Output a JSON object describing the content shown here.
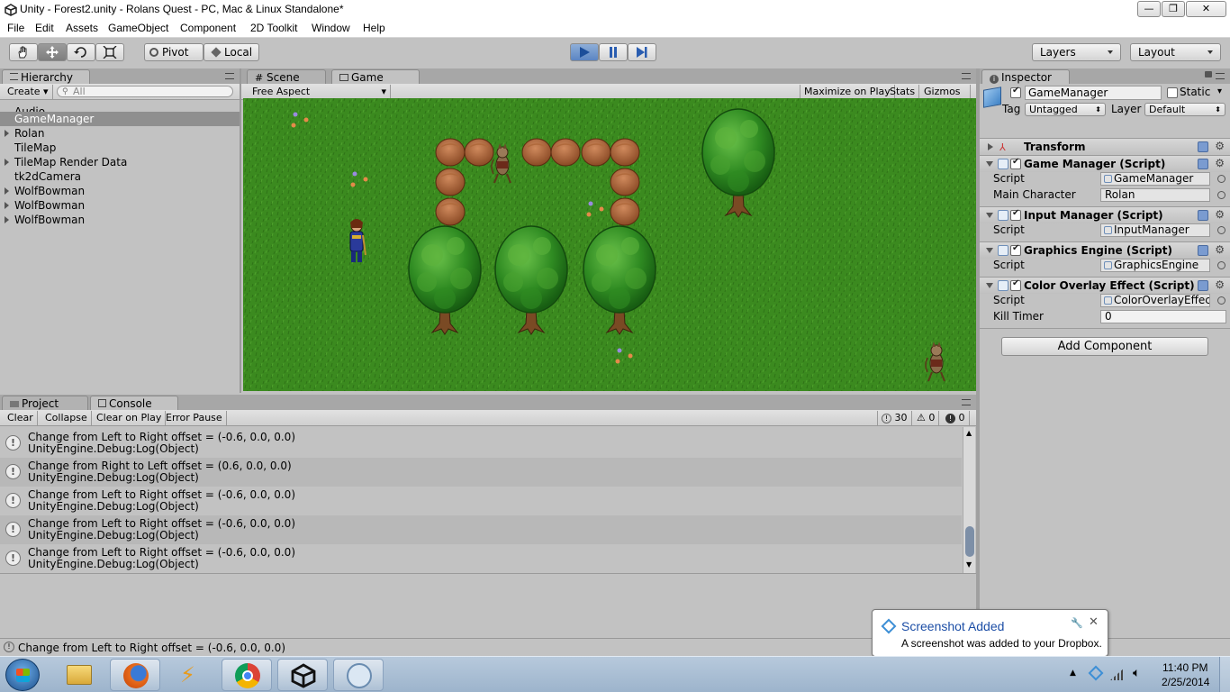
{
  "window": {
    "title": "Unity - Forest2.unity - Rolans Quest - PC, Mac & Linux Standalone*",
    "minimize": "—",
    "maximize": "❐",
    "close": "✕"
  },
  "menu": [
    "File",
    "Edit",
    "Assets",
    "GameObject",
    "Component",
    "2D Toolkit",
    "Window",
    "Help"
  ],
  "toolbar": {
    "pivot": "Pivot",
    "local": "Local",
    "layers": "Layers",
    "layout": "Layout"
  },
  "hierarchy": {
    "tab": "Hierarchy",
    "create": "Create",
    "search_placeholder": "All",
    "items": [
      {
        "label": "Audio"
      },
      {
        "label": "GameManager"
      },
      {
        "label": "Rolan"
      },
      {
        "label": "TileMap"
      },
      {
        "label": "TileMap Render Data"
      },
      {
        "label": "tk2dCamera"
      },
      {
        "label": "WolfBowman"
      },
      {
        "label": "WolfBowman"
      },
      {
        "label": "WolfBowman"
      }
    ]
  },
  "game_view": {
    "tab_scene": "Scene",
    "tab_game": "Game",
    "aspect": "Free Aspect",
    "maximize_on_play": "Maximize on Play",
    "stats": "Stats",
    "gizmos": "Gizmos"
  },
  "inspector": {
    "tab": "Inspector",
    "object_name": "GameManager",
    "static_label": "Static",
    "tag_label": "Tag",
    "tag_value": "Untagged",
    "layer_label": "Layer",
    "layer_value": "Default",
    "transform": "Transform",
    "components": [
      {
        "name": "Game Manager (Script)",
        "script_label": "Script",
        "script_value": "GameManager",
        "extra_label": "Main Character",
        "extra_value": "Rolan"
      },
      {
        "name": "Input Manager (Script)",
        "script_label": "Script",
        "script_value": "InputManager"
      },
      {
        "name": "Graphics Engine (Script)",
        "script_label": "Script",
        "script_value": "GraphicsEngine"
      },
      {
        "name": "Color Overlay Effect (Script)",
        "script_label": "Script",
        "script_value": "ColorOverlayEffec",
        "extra_label": "Kill Timer",
        "extra_value": "0"
      }
    ],
    "add_component": "Add Component"
  },
  "console": {
    "tab_project": "Project",
    "tab_console": "Console",
    "buttons": [
      "Clear",
      "Collapse",
      "Clear on Play",
      "Error Pause"
    ],
    "count_info": "30",
    "count_warn": "0",
    "count_error": "0",
    "logs": [
      {
        "line1": "Change from Left to Right offset = (-0.6, 0.0, 0.0)",
        "line2": "UnityEngine.Debug:Log(Object)"
      },
      {
        "line1": "Change from Right to Left offset = (0.6, 0.0, 0.0)",
        "line2": "UnityEngine.Debug:Log(Object)"
      },
      {
        "line1": "Change from Left to Right offset = (-0.6, 0.0, 0.0)",
        "line2": "UnityEngine.Debug:Log(Object)"
      },
      {
        "line1": "Change from Left to Right offset = (-0.6, 0.0, 0.0)",
        "line2": "UnityEngine.Debug:Log(Object)"
      },
      {
        "line1": "Change from Left to Right offset = (-0.6, 0.0, 0.0)",
        "line2": "UnityEngine.Debug:Log(Object)"
      }
    ]
  },
  "status": {
    "message": "Change from Left to Right offset = (-0.6, 0.0, 0.0)"
  },
  "notification": {
    "title": "Screenshot Added",
    "body": "A screenshot was added to your Dropbox."
  },
  "taskbar": {
    "time": "11:40 PM",
    "date": "2/25/2014"
  },
  "colors": {
    "grass": "#3b8a1f",
    "play_active": "#5b85c3",
    "selection": "#8f8f8f"
  }
}
